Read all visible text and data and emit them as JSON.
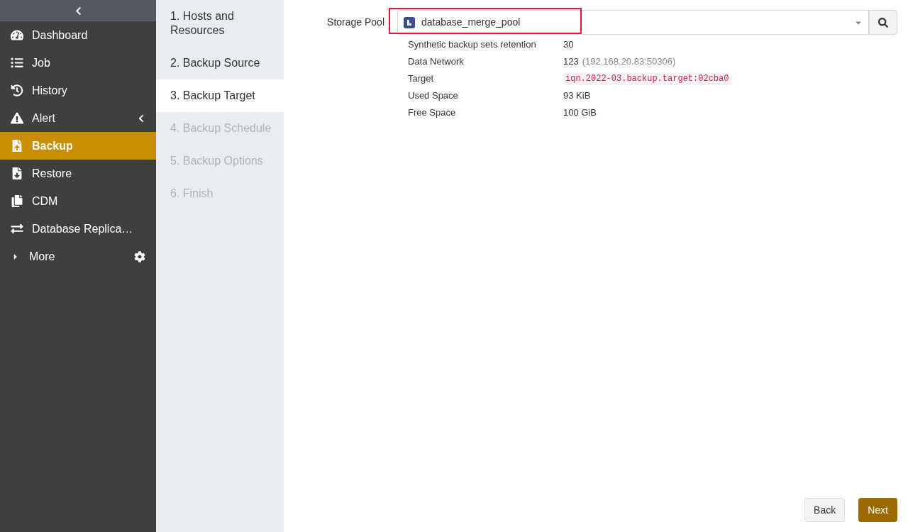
{
  "sidebar": {
    "items": [
      {
        "label": "Dashboard",
        "selected": false
      },
      {
        "label": "Job",
        "selected": false
      },
      {
        "label": "History",
        "selected": false
      },
      {
        "label": "Alert",
        "selected": false,
        "expanded": false
      },
      {
        "label": "Backup",
        "selected": true
      },
      {
        "label": "Restore",
        "selected": false
      },
      {
        "label": "CDM",
        "selected": false
      },
      {
        "label": "Database Replica…",
        "selected": false
      },
      {
        "label": "More",
        "selected": false
      }
    ]
  },
  "steps": [
    {
      "label": "1. Hosts and Resources",
      "selected": false,
      "disabled": false
    },
    {
      "label": "2. Backup Source",
      "selected": false,
      "disabled": false
    },
    {
      "label": "3. Backup Target",
      "selected": true,
      "disabled": false
    },
    {
      "label": "4. Backup Schedule",
      "selected": false,
      "disabled": true
    },
    {
      "label": "5. Backup Options",
      "selected": false,
      "disabled": true
    },
    {
      "label": "6. Finish",
      "selected": false,
      "disabled": true
    }
  ],
  "storage_pool": {
    "label": "Storage Pool",
    "value": "database_merge_pool",
    "highlighted": true
  },
  "details": [
    {
      "label": "Synthetic backup sets retention",
      "value": "30",
      "kind": "text"
    },
    {
      "label": "Data Network",
      "value": "123",
      "note": "(192.168.20.83:50306)",
      "kind": "text"
    },
    {
      "label": "Target",
      "value": "iqn.2022-03.backup.target:02cba0",
      "kind": "code"
    },
    {
      "label": "Used Space",
      "value": "93 KiB",
      "kind": "text"
    },
    {
      "label": "Free Space",
      "value": "100 GiB",
      "kind": "text"
    }
  ],
  "buttons": {
    "back": "Back",
    "next": "Next"
  }
}
